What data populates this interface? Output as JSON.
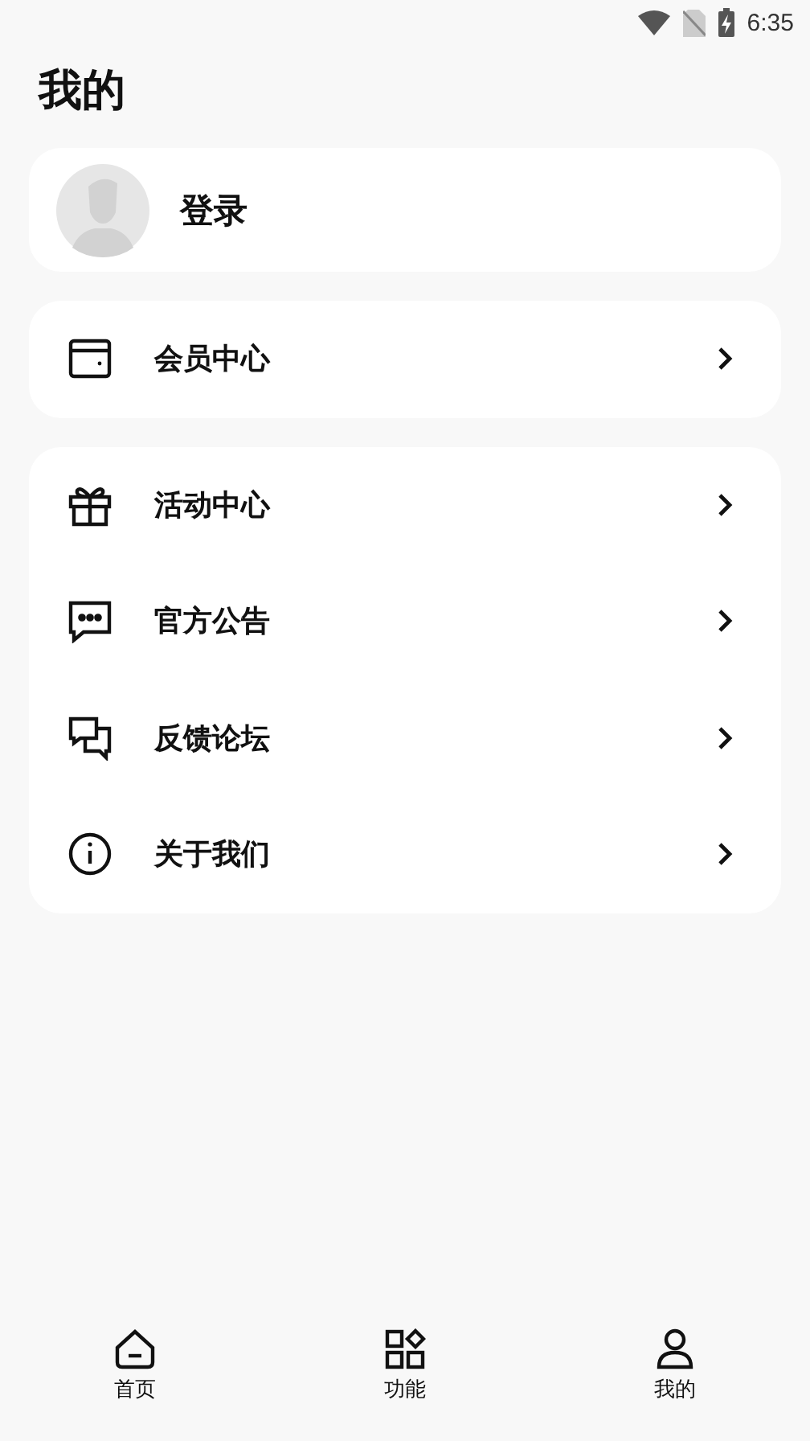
{
  "status_bar": {
    "time": "6:35"
  },
  "title": "我的",
  "login": {
    "label": "登录"
  },
  "member_menu": [
    {
      "label": "会员中心"
    }
  ],
  "menu": [
    {
      "label": "活动中心"
    },
    {
      "label": "官方公告"
    },
    {
      "label": "反馈论坛"
    },
    {
      "label": "关于我们"
    }
  ],
  "bottom_nav": [
    {
      "label": "首页"
    },
    {
      "label": "功能"
    },
    {
      "label": "我的"
    }
  ]
}
